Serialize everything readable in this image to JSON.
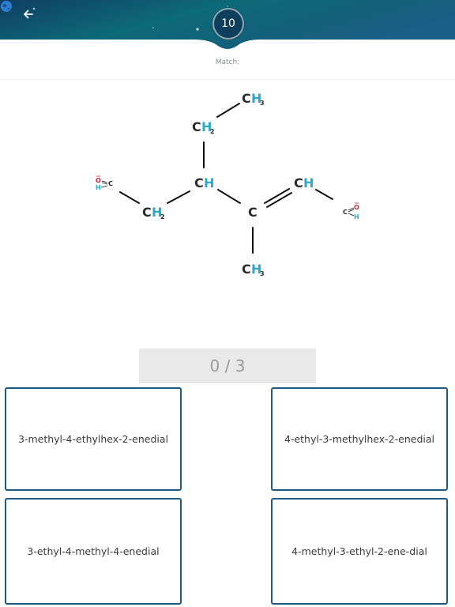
{
  "header": {
    "level": "10",
    "colors": {
      "gradient_start": "#0f3e63",
      "gradient_mid": "#0d6a77",
      "gradient_end": "#1a5f86",
      "badge": "#0e3f5c"
    }
  },
  "prompt": "Match:",
  "molecule": {
    "atoms": {
      "ch3_top": "CH3",
      "ch2_upper": "CH2",
      "ch_center": "CH",
      "ch2_left": "CH2",
      "c_center": "C",
      "ch_right": "CH",
      "ch3_bottom": "CH3",
      "cho_left": "CHO",
      "cho_right": "CHO"
    },
    "colors": {
      "carbon": "#2b2b2b",
      "hydrogen": "#2aa9cc",
      "oxygen": "#d0243f",
      "bond": "#111111"
    }
  },
  "score": "0 / 3",
  "answers": [
    "3-methyl-4-ethylhex-2-enedial",
    "4-ethyl-3-methylhex-2-enedial",
    "3-ethyl-4-methyl-4-enedial",
    "4-methyl-3-ethyl-2-ene-dial"
  ],
  "icons": {
    "back": "arrow-left-icon",
    "globe": "globe-icon"
  }
}
